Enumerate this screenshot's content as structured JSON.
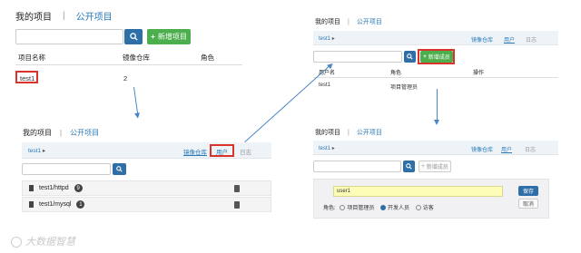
{
  "panel1": {
    "tab_active": "我的项目",
    "tab_sep": "|",
    "tab_link": "公开项目",
    "new_project_button": "新增项目",
    "table_headers": [
      "项目名称",
      "镜像仓库",
      "角色"
    ],
    "row": {
      "name": "test1",
      "repos": "2",
      "role": ""
    }
  },
  "panel2": {
    "tab_active": "我的项目",
    "tab_sep": "|",
    "tab_link": "公开项目",
    "breadcrumb": "test1",
    "nav_tabs": [
      "镜像仓库",
      "用户",
      "日志"
    ],
    "repos": [
      {
        "name": "test1/httpd",
        "count": "9"
      },
      {
        "name": "test1/mysql",
        "count": "1"
      }
    ]
  },
  "panel3": {
    "tab_active": "我的项目",
    "tab_sep": "|",
    "tab_link": "公开项目",
    "breadcrumb": "test1",
    "nav_tabs": [
      "镜像仓库",
      "用户",
      "日志"
    ],
    "add_member_button": "新增成员",
    "table_headers": [
      "用户名",
      "角色",
      "操作"
    ],
    "row": {
      "user": "test1",
      "role": "项目管理员"
    }
  },
  "panel4": {
    "tab_active": "我的项目",
    "tab_sep": "|",
    "tab_link": "公开项目",
    "breadcrumb": "test1",
    "nav_tabs": [
      "镜像仓库",
      "用户",
      "日志"
    ],
    "add_member_button": "新增成员",
    "username_value": "user1",
    "save_button": "保存",
    "cancel_button": "取消",
    "role_label": "角色:",
    "role_options": [
      "项目管理员",
      "开发人员",
      "访客"
    ],
    "selected_role_index": 1
  },
  "watermark": "大数据智慧",
  "colors": {
    "primary": "#2e6fa8",
    "success": "#4cae4c",
    "highlight": "#d9332c",
    "link": "#2a7ab8"
  }
}
